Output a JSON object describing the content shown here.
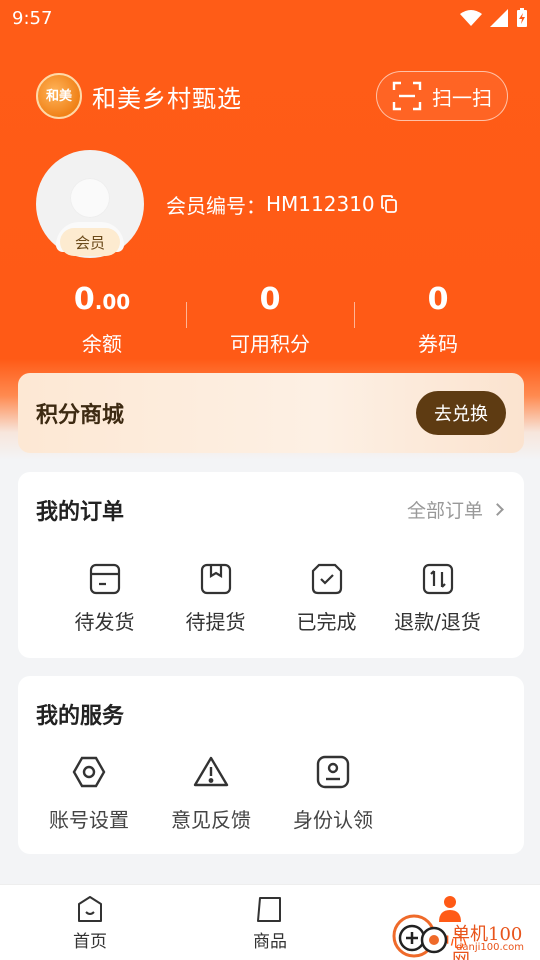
{
  "status_bar": {
    "time": "9:57"
  },
  "header": {
    "logo_text": "和美",
    "app_title": "和美乡村甄选",
    "scan_label": "扫一扫"
  },
  "profile": {
    "badge": "会员",
    "member_id_label": "会员编号：",
    "member_id": "HM112310"
  },
  "stats": [
    {
      "value_int": "0",
      "value_dec": ".00",
      "label": "余额"
    },
    {
      "value_int": "0",
      "value_dec": "",
      "label": "可用积分"
    },
    {
      "value_int": "0",
      "value_dec": "",
      "label": "券码"
    }
  ],
  "points_mall": {
    "title": "积分商城",
    "button": "去兑换"
  },
  "orders": {
    "title": "我的订单",
    "all_link": "全部订单",
    "items": [
      {
        "label": "待发货",
        "icon": "box-icon"
      },
      {
        "label": "待提货",
        "icon": "package-icon"
      },
      {
        "label": "已完成",
        "icon": "check-shield-icon"
      },
      {
        "label": "退款/退货",
        "icon": "refund-icon"
      }
    ]
  },
  "services": {
    "title": "我的服务",
    "items": [
      {
        "label": "账号设置",
        "icon": "settings-hex-icon"
      },
      {
        "label": "意见反馈",
        "icon": "warning-icon"
      },
      {
        "label": "身份认领",
        "icon": "id-card-icon"
      }
    ]
  },
  "bottom_nav": [
    {
      "label": "首页",
      "icon": "home-icon"
    },
    {
      "label": "商品",
      "icon": "goods-icon"
    },
    {
      "label": "中心",
      "icon": "user-icon"
    }
  ],
  "watermark": {
    "text": "单机100网",
    "sub": "danji100.com"
  },
  "colors": {
    "brand": "#ff5a16",
    "accent_dark": "#5e3b12"
  }
}
